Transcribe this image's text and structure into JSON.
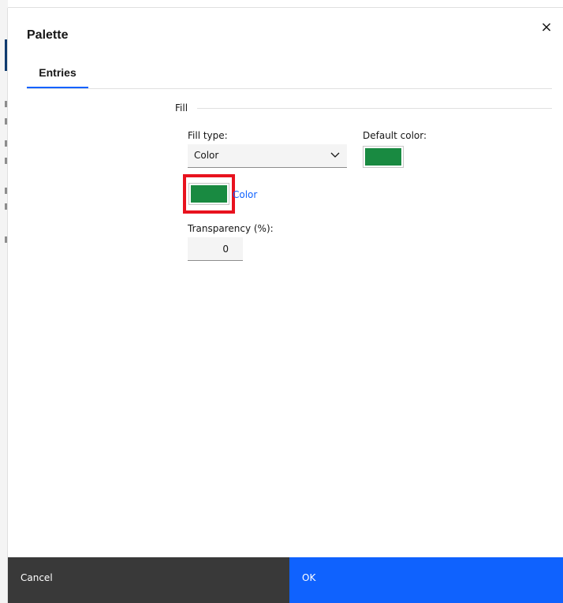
{
  "dialog": {
    "title": "Palette",
    "close_glyph": "×"
  },
  "tabs": [
    {
      "label": "Entries",
      "active": true
    }
  ],
  "fill": {
    "section_label": "Fill",
    "fill_type_label": "Fill type:",
    "fill_type_value": "Color",
    "default_color_label": "Default color:",
    "color_link": "Color",
    "transparency_label": "Transparency (%):",
    "transparency_value": "0",
    "swatch_color": "#198a41"
  },
  "footer": {
    "cancel_label": "Cancel",
    "ok_label": "OK"
  },
  "colors": {
    "accent": "#0f62fe",
    "highlight": "#e8121e",
    "cancel_bg": "#393939"
  },
  "icons": {
    "close": "close-icon",
    "dropdown": "chevron-down-icon"
  }
}
